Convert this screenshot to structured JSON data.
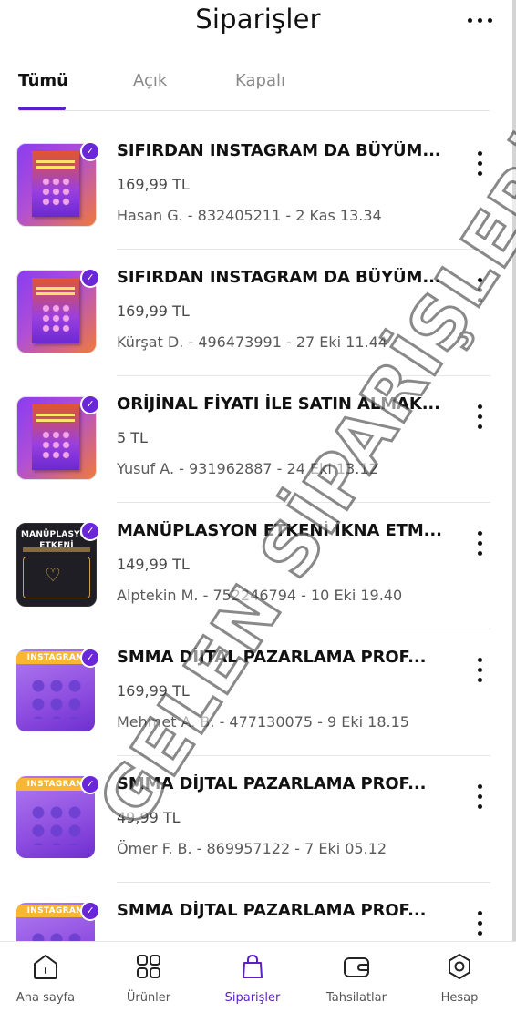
{
  "header": {
    "title": "Siparişler",
    "more_icon": "more-horizontal-icon"
  },
  "tabs": [
    {
      "label": "Tümü",
      "active": true
    },
    {
      "label": "Açık",
      "active": false
    },
    {
      "label": "Kapalı",
      "active": false
    }
  ],
  "orders": [
    {
      "title": "SIFIRDAN INSTAGRAM DA BÜYÜM...",
      "price": "169,99 TL",
      "meta": "Hasan G. - 832405211 - 2 Kas 13.34",
      "thumb": "book"
    },
    {
      "title": "SIFIRDAN INSTAGRAM DA BÜYÜM...",
      "price": "169,99 TL",
      "meta": "Kürşat D. - 496473991 - 27 Eki 11.44",
      "thumb": "book"
    },
    {
      "title": "ORİJİNAL FİYATI İLE SATIN ALMAK...",
      "price": "5 TL",
      "meta": "Yusuf A. - 931962887 - 24 Eki 13.12",
      "thumb": "book"
    },
    {
      "title": "MANÜPLASYON ETKENİ İKNA ETM...",
      "price": "149,99 TL",
      "meta": "Alptekin M. - 752246794 - 10 Eki 19.40",
      "thumb": "dark",
      "thumb_text": "MANÜPLASYON ETKENİ"
    },
    {
      "title": "SMMA DİJTAL PAZARLAMA PROF...",
      "price": "169,99 TL",
      "meta": "Mehmet A. B. - 477130075 - 9 Eki 18.15",
      "thumb": "violet",
      "thumb_text": "INSTAGRAM"
    },
    {
      "title": "SMMA DİJTAL PAZARLAMA PROF...",
      "price": "49,99 TL",
      "meta": "Ömer F. B. - 869957122 - 7 Eki 05.12",
      "thumb": "violet",
      "thumb_text": "INSTAGRAM"
    },
    {
      "title": "SMMA DİJTAL PAZARLAMA PROF...",
      "price": "",
      "meta": "",
      "thumb": "violet",
      "thumb_text": "INSTAGRAM"
    }
  ],
  "watermark": "GELEN SİPARİŞLERİM",
  "bottom_nav": [
    {
      "label": "Ana sayfa",
      "icon": "home-icon",
      "active": false
    },
    {
      "label": "Ürünler",
      "icon": "grid-icon",
      "active": false
    },
    {
      "label": "Siparişler",
      "icon": "bag-icon",
      "active": true
    },
    {
      "label": "Tahsilatlar",
      "icon": "wallet-icon",
      "active": false
    },
    {
      "label": "Hesap",
      "icon": "settings-icon",
      "active": false
    }
  ],
  "colors": {
    "accent": "#5a1fc7",
    "badge": "#6a26d9",
    "text": "#111111",
    "muted": "#8a8a8a"
  }
}
